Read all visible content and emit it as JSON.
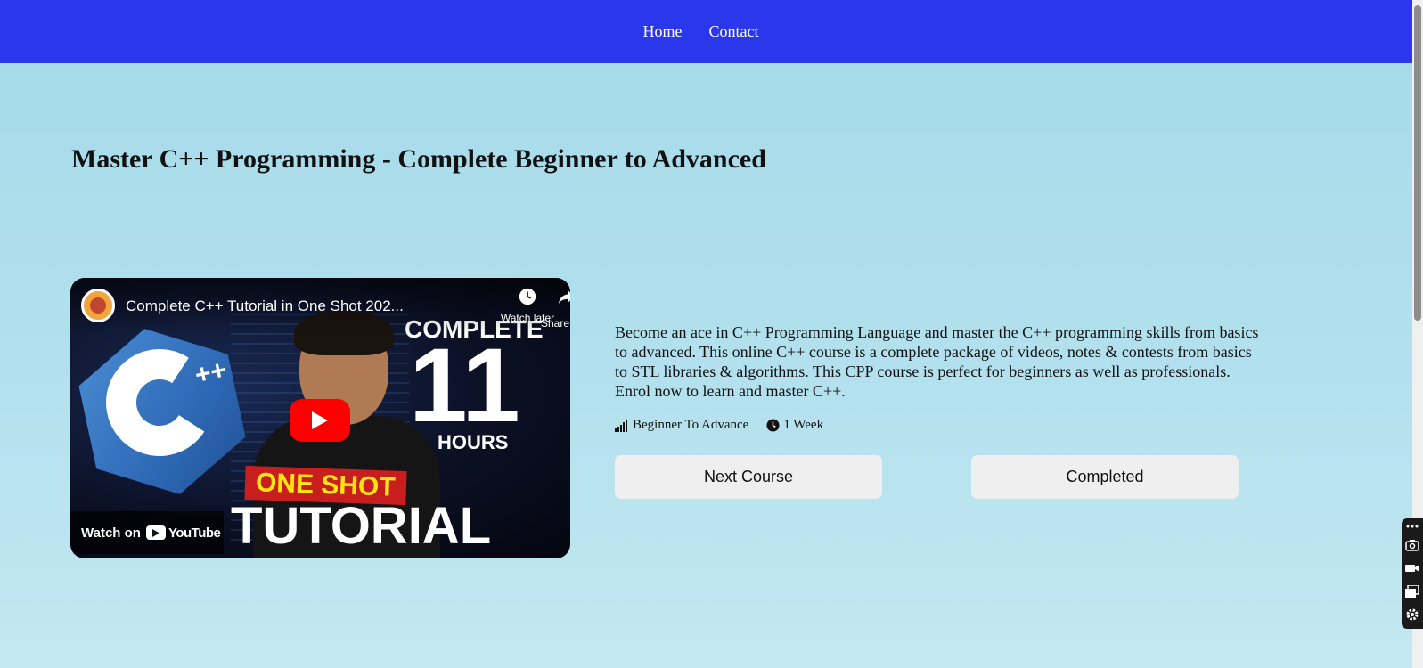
{
  "nav": {
    "links": [
      "Home",
      "Contact"
    ]
  },
  "course": {
    "title": "Master C++ Programming - Complete Beginner to Advanced",
    "description": "Become an ace in C++ Programming Language and master the C++ programming skills from basics to advanced. This online C++ course is a complete package of videos, notes & contests from basics to STL libraries & algorithms. This CPP course is perfect for beginners as well as professionals. Enrol now to learn and master C++.",
    "level": "Beginner To Advance",
    "duration": "1 Week",
    "next_button": "Next Course",
    "completed_button": "Completed"
  },
  "video": {
    "title": "Complete C++ Tutorial in One Shot 202...",
    "watch_later": "Watch later",
    "share": "Share",
    "watch_on": "Watch on",
    "youtube": "YouTube",
    "thumbnail": {
      "complete": "COMPLETE",
      "number": "11",
      "hours": "HOURS",
      "one_shot": "ONE SHOT",
      "tutorial": "TUTORIAL",
      "logo_plus": "++"
    }
  },
  "colors": {
    "navbar": "#2b37ea",
    "background": "#a4dae9",
    "button": "#efefef",
    "play": "#ff0000"
  }
}
